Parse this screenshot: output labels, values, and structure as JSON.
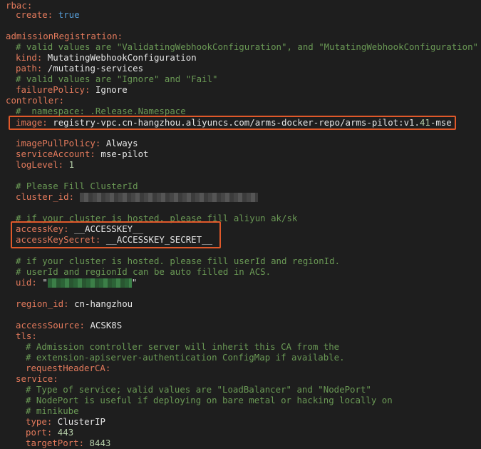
{
  "lines": {
    "l0": {
      "key": "rbac:"
    },
    "l1": {
      "key": "create:",
      "value": "true"
    },
    "l3": {
      "key": "admissionRegistration:"
    },
    "l4": {
      "comment": "# valid values are \"ValidatingWebhookConfiguration\", and \"MutatingWebhookConfiguration\""
    },
    "l5": {
      "key": "kind:",
      "value": "MutatingWebhookConfiguration"
    },
    "l6": {
      "key": "path:",
      "value": "/mutating-services"
    },
    "l7": {
      "comment": "# valid values are \"Ignore\" and \"Fail\""
    },
    "l8": {
      "key": "failurePolicy:",
      "value": "Ignore"
    },
    "l9": {
      "key": "controller:"
    },
    "l10": {
      "comment": "#  namespace: .Release.Namespace"
    },
    "l11": {
      "key": "image:",
      "value": "registry-vpc.cn-hangzhou.aliyuncs.com/arms-docker-repo/arms-pilot:v1.",
      "value2": "41",
      "value3": "-mse"
    },
    "l13": {
      "key": "imagePullPolicy:",
      "value": "Always"
    },
    "l14": {
      "key": "serviceAccount:",
      "value": "mse-pilot"
    },
    "l15": {
      "key": "logLevel:",
      "value": "1"
    },
    "l17": {
      "comment": "# Please Fill ClusterId"
    },
    "l18": {
      "key": "cluster_id:"
    },
    "l20": {
      "comment": "# if your cluster is hosted. please fill aliyun ak/sk"
    },
    "l21": {
      "key": "accessKey:",
      "value": "__ACCESSKEY__"
    },
    "l22": {
      "key": "accessKeySecret:",
      "value": "__ACCESSKEY_SECRET__"
    },
    "l24": {
      "comment": "# if your cluster is hosted. please fill userId and regionId."
    },
    "l25": {
      "comment": "# userId and regionId can be auto filled in ACS."
    },
    "l26": {
      "key": "uid:",
      "q1": "\"",
      "q2": "\""
    },
    "l28": {
      "key": "region_id:",
      "value": "cn-hangzhou"
    },
    "l30": {
      "key": "accessSource:",
      "value": "ACSK8S"
    },
    "l31": {
      "key": "tls:"
    },
    "l32": {
      "comment": "# Admission controller server will inherit this CA from the"
    },
    "l33": {
      "comment": "# extension-apiserver-authentication ConfigMap if available."
    },
    "l34": {
      "key": "requestHeaderCA:"
    },
    "l35": {
      "key": "service:"
    },
    "l36": {
      "comment": "# Type of service; valid values are \"LoadBalancer\" and \"NodePort\""
    },
    "l37": {
      "comment": "# NodePort is useful if deploying on bare metal or hacking locally on"
    },
    "l38": {
      "comment": "# minikube"
    },
    "l39": {
      "key": "type:",
      "value": "ClusterIP"
    },
    "l40": {
      "key": "port:",
      "value": "443"
    },
    "l41": {
      "key": "targetPort:",
      "value": "8443"
    }
  },
  "colors": {
    "background": "#1e1e1e",
    "key": "#e37a5c",
    "string": "#e6e6e6",
    "number": "#b5cea8",
    "boolean": "#569cd6",
    "comment": "#6a9955",
    "highlight_box": "#e0592a"
  }
}
